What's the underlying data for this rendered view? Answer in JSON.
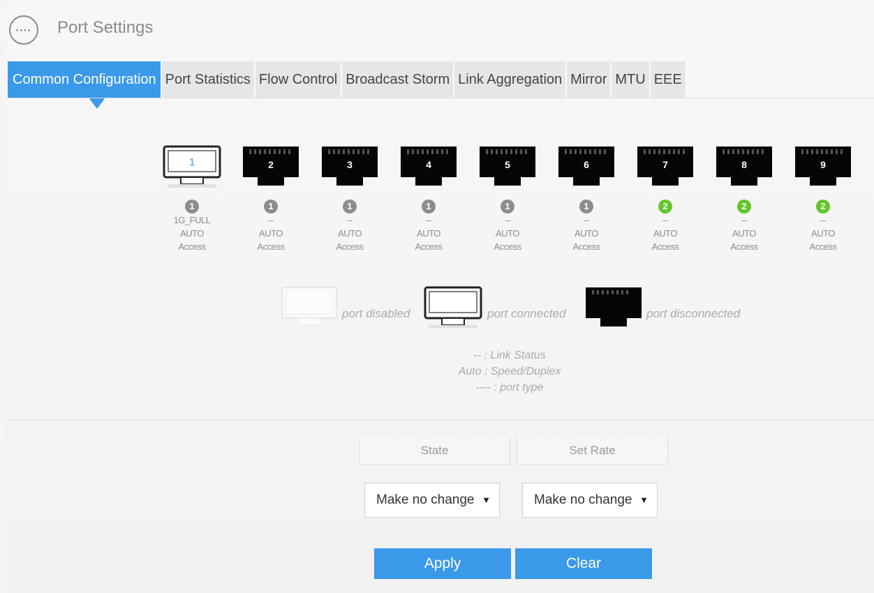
{
  "header": {
    "title": "Port Settings",
    "icon": "more-dots-icon",
    "icon_glyph": "····"
  },
  "tabs": [
    {
      "label": "Common Configuration",
      "active": true
    },
    {
      "label": "Port Statistics"
    },
    {
      "label": "Flow Control"
    },
    {
      "label": "Broadcast Storm"
    },
    {
      "label": "Link Aggregation"
    },
    {
      "label": "Mirror"
    },
    {
      "label": "MTU"
    },
    {
      "label": "EEE"
    }
  ],
  "ports": [
    {
      "num": "1",
      "state": "connected",
      "badge": "1",
      "badge_color": "grey",
      "link": "1G_FULL",
      "speed": "AUTO",
      "type": "Access"
    },
    {
      "num": "2",
      "state": "disconnected",
      "badge": "1",
      "badge_color": "grey",
      "link": "--",
      "speed": "AUTO",
      "type": "Access"
    },
    {
      "num": "3",
      "state": "disconnected",
      "badge": "1",
      "badge_color": "grey",
      "link": "--",
      "speed": "AUTO",
      "type": "Access"
    },
    {
      "num": "4",
      "state": "disconnected",
      "badge": "1",
      "badge_color": "grey",
      "link": "--",
      "speed": "AUTO",
      "type": "Access"
    },
    {
      "num": "5",
      "state": "disconnected",
      "badge": "1",
      "badge_color": "grey",
      "link": "--",
      "speed": "AUTO",
      "type": "Access"
    },
    {
      "num": "6",
      "state": "disconnected",
      "badge": "1",
      "badge_color": "grey",
      "link": "--",
      "speed": "AUTO",
      "type": "Access"
    },
    {
      "num": "7",
      "state": "disconnected",
      "badge": "2",
      "badge_color": "green",
      "link": "--",
      "speed": "AUTO",
      "type": "Access"
    },
    {
      "num": "8",
      "state": "disconnected",
      "badge": "2",
      "badge_color": "green",
      "link": "--",
      "speed": "AUTO",
      "type": "Access"
    },
    {
      "num": "9",
      "state": "disconnected",
      "badge": "2",
      "badge_color": "green",
      "link": "--",
      "speed": "AUTO",
      "type": "Access"
    }
  ],
  "legend": {
    "disabled": "port disabled",
    "connected": "port connected",
    "disconnected": "port disconnected",
    "keys": [
      "-- : Link Status",
      "Auto : Speed/Duplex",
      "---- : port type"
    ]
  },
  "table": {
    "headers": [
      "State",
      "Set Rate"
    ],
    "state_value": "Make no change",
    "rate_value": "Make no change",
    "dropdown_arrow": "▼"
  },
  "buttons": {
    "apply": "Apply",
    "clear": "Clear"
  },
  "colors": {
    "accent": "#3b99ea",
    "badge_grey": "#8d8d8d",
    "badge_green": "#64c52a"
  }
}
